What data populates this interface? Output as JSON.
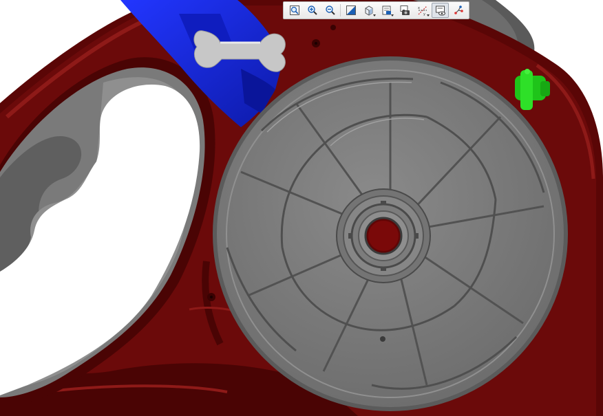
{
  "colors": {
    "background": "#ffffff",
    "housing": "#6b0a0a",
    "housing_dark": "#3e0303",
    "housing_light": "#8e1a18",
    "grip": "#7a7a7a",
    "reel": "#7b7b7b",
    "blue_part": "#1a2be6",
    "green_part": "#22d21c",
    "bone": "#c9c9c9"
  },
  "toolbar": {
    "buttons": [
      {
        "name": "zoom-to-fit",
        "icon": "zoom-fit-icon"
      },
      {
        "name": "zoom-in",
        "icon": "zoom-in-icon"
      },
      {
        "name": "zoom-out",
        "icon": "zoom-out-icon"
      },
      {
        "name": "view-normal",
        "icon": "view-normal-icon"
      },
      {
        "name": "display-style",
        "icon": "display-style-icon"
      },
      {
        "name": "saved-views",
        "icon": "saved-views-icon"
      },
      {
        "name": "screenshot",
        "icon": "camera-icon"
      },
      {
        "name": "datum-display",
        "icon": "datum-axes-icon"
      },
      {
        "name": "annotation-display",
        "icon": "annotation-icon"
      },
      {
        "name": "spin-center",
        "icon": "spin-center-icon"
      }
    ]
  }
}
